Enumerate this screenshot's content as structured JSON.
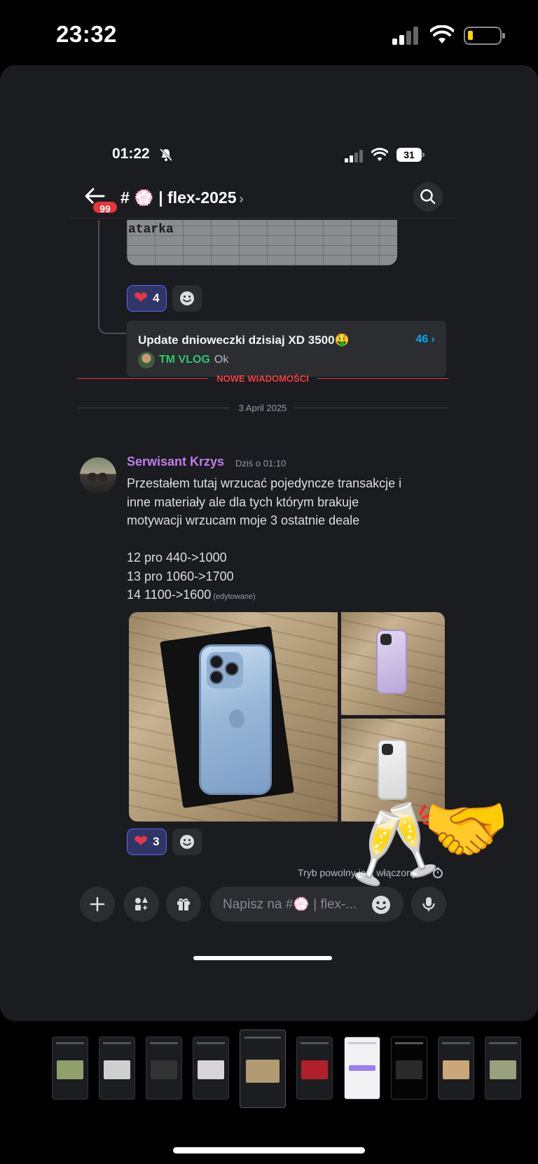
{
  "outer_status": {
    "time": "23:32"
  },
  "inner_status": {
    "time": "01:22",
    "battery": "31"
  },
  "channel": {
    "unread_badge": "99",
    "title": "# 💮 | flex-2025",
    "chevron": "›"
  },
  "prev_image_text": "atarka",
  "reactions_prev": {
    "heart_count": "4"
  },
  "thread": {
    "title": "Update dnioweczki dzisiaj XD 3500🤑",
    "count": "46 ›",
    "last_user": "TM VLOG",
    "last_message": "Ok"
  },
  "separators": {
    "new_messages": "NOWE WIADOMOŚCI",
    "date": "3 April 2025"
  },
  "message": {
    "author": "Serwisant Krzys",
    "time": "Dziś o 01:10",
    "lines": [
      "Przestałem tutaj wrzucać pojedyncze transakcje i",
      "inne materiały ale dla tych którym brakuje",
      "motywacji wrzucam moje 3 ostatnie deale",
      "12 pro 440->1000",
      "13 pro 1060->1700",
      "14 1100->1600"
    ],
    "edited": "(edytowane)",
    "heart_count": "3"
  },
  "slow_mode": "Tryb powolny jest włączony.",
  "composer": {
    "placeholder": "Napisz na #💮 | flex-..."
  },
  "stickers": {
    "glasses": "🥂",
    "handshake": "🤝"
  },
  "icons": [
    "back-arrow-icon",
    "search-icon",
    "plus-icon",
    "apps-icon",
    "gift-icon",
    "emoji-icon",
    "microphone-icon",
    "bell-slash-icon",
    "clock-icon"
  ],
  "colors": {
    "accent": "#5865f2",
    "new_messages": "#f23f42",
    "author": "#c17ee8",
    "thread_user": "#2dc770",
    "link": "#00a8fc"
  }
}
